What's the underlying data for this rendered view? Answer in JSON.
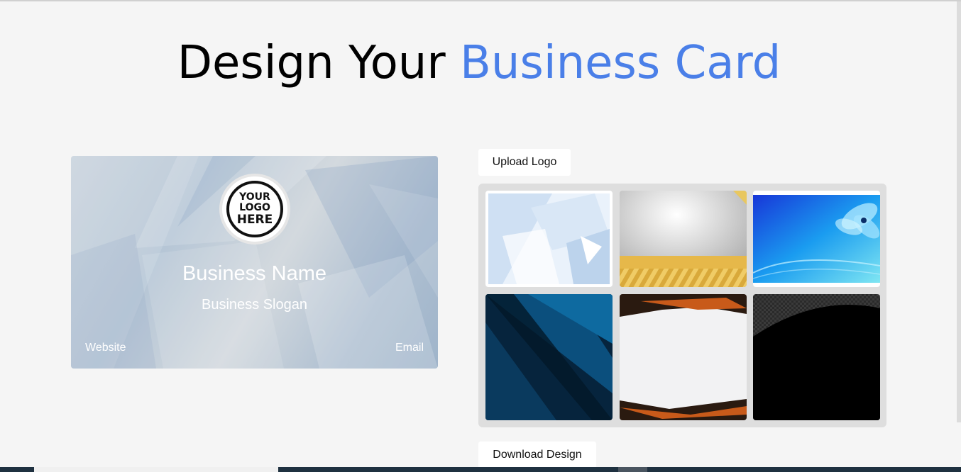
{
  "header": {
    "title_part1": "Design Your ",
    "title_part2": "Business Card",
    "accent_color": "#4a7fe8"
  },
  "card": {
    "logo_lines": [
      "YOUR",
      "LOGO",
      "HERE"
    ],
    "business_name": "Business Name",
    "slogan": "Business Slogan",
    "website": "Website",
    "email": "Email"
  },
  "controls": {
    "upload_label": "Upload Logo",
    "download_label": "Download Design"
  },
  "templates": [
    {
      "name": "light-blue-geometric"
    },
    {
      "name": "silver-gold-stripe"
    },
    {
      "name": "blue-flower"
    },
    {
      "name": "dark-blue-diagonal"
    },
    {
      "name": "orange-black-frame"
    },
    {
      "name": "black-carbon"
    }
  ]
}
